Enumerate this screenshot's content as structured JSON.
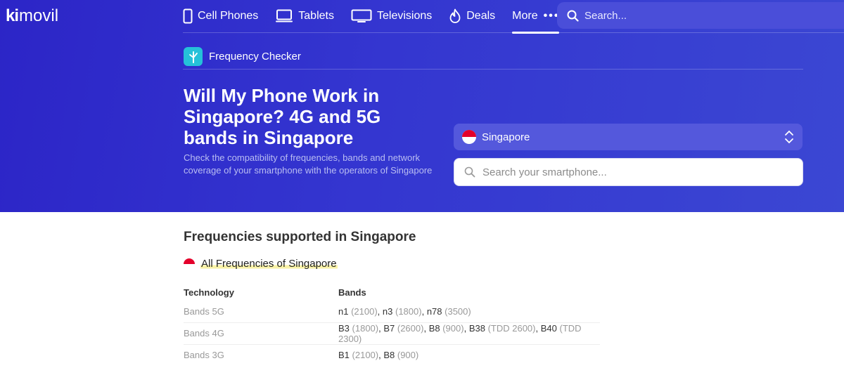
{
  "nav": {
    "logo_k": "ki",
    "logo_text": "movil",
    "items": [
      {
        "label": "Cell Phones",
        "icon": "phone-icon"
      },
      {
        "label": "Tablets",
        "icon": "tablet-icon"
      },
      {
        "label": "Televisions",
        "icon": "tv-icon"
      },
      {
        "label": "Deals",
        "icon": "flame-icon"
      },
      {
        "label": "More",
        "icon": "more-dots-icon"
      }
    ],
    "more_dots": "•••",
    "search_placeholder": "Search..."
  },
  "hero": {
    "section_label": "Frequency Checker",
    "title": "Will My Phone Work in Singapore? 4G and 5G bands in Singapore",
    "description": "Check the compatibility of frequencies, bands and network coverage of your smartphone with the operators of Singapore",
    "country": "Singapore",
    "phone_search_placeholder": "Search your smartphone..."
  },
  "content": {
    "title": "Frequencies supported in Singapore",
    "all_frequencies_link": "All Frequencies of Singapore",
    "table": {
      "headers": [
        "Technology",
        "Bands"
      ],
      "rows": [
        {
          "technology": "Bands 5G",
          "bands": [
            {
              "name": "n1",
              "freq": "(2100)"
            },
            {
              "name": "n3",
              "freq": "(1800)"
            },
            {
              "name": "n78",
              "freq": "(3500)"
            }
          ]
        },
        {
          "technology": "Bands 4G",
          "bands": [
            {
              "name": "B3",
              "freq": "(1800)"
            },
            {
              "name": "B7",
              "freq": "(2600)"
            },
            {
              "name": "B8",
              "freq": "(900)"
            },
            {
              "name": "B38",
              "freq": "(TDD 2600)"
            },
            {
              "name": "B40",
              "freq": "(TDD 2300)"
            }
          ]
        },
        {
          "technology": "Bands 3G",
          "bands": [
            {
              "name": "B1",
              "freq": "(2100)"
            },
            {
              "name": "B8",
              "freq": "(900)"
            }
          ]
        }
      ]
    }
  },
  "colors": {
    "hero_bg": "#3436d0",
    "accent_cyan": "#25c1d9",
    "highlight": "#f9f2a6",
    "flag_red": "#e4002b"
  }
}
